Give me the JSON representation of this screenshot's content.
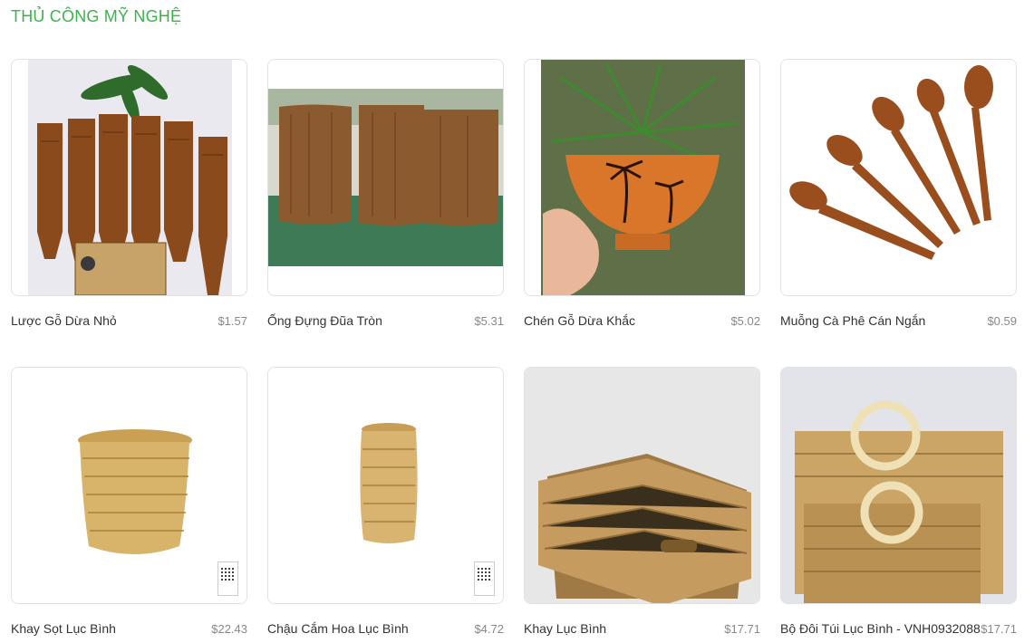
{
  "section": {
    "title": "THỦ CÔNG MỸ NGHỆ"
  },
  "products": [
    {
      "name": "Lược Gỗ Dừa Nhỏ",
      "price": "$1.57",
      "image": "coconut-wood-combs"
    },
    {
      "name": "Ống Đựng Đũa Tròn",
      "price": "$5.31",
      "image": "coconut-wood-cups"
    },
    {
      "name": "Chén Gỗ Dừa Khắc",
      "price": "$5.02",
      "image": "carved-coconut-bowl"
    },
    {
      "name": "Muỗng Cà Phê Cán Ngắn",
      "price": "$0.59",
      "image": "coconut-wood-spoons"
    },
    {
      "name": "Khay Sọt Lục Bình",
      "price": "$22.43",
      "image": "water-hyacinth-basket"
    },
    {
      "name": "Chậu Cắm Hoa Lục Bình",
      "price": "$4.72",
      "image": "water-hyacinth-vase"
    },
    {
      "name": "Khay Lục Bình",
      "price": "$17.71",
      "image": "water-hyacinth-tray"
    },
    {
      "name": "Bộ Đôi Túi Lục Bình - VNH0932088",
      "price": "$17.71",
      "image": "water-hyacinth-bags"
    }
  ],
  "colors": {
    "accent": "#3cb44b",
    "price": "#888888",
    "card_border": "#e2e2e2"
  }
}
